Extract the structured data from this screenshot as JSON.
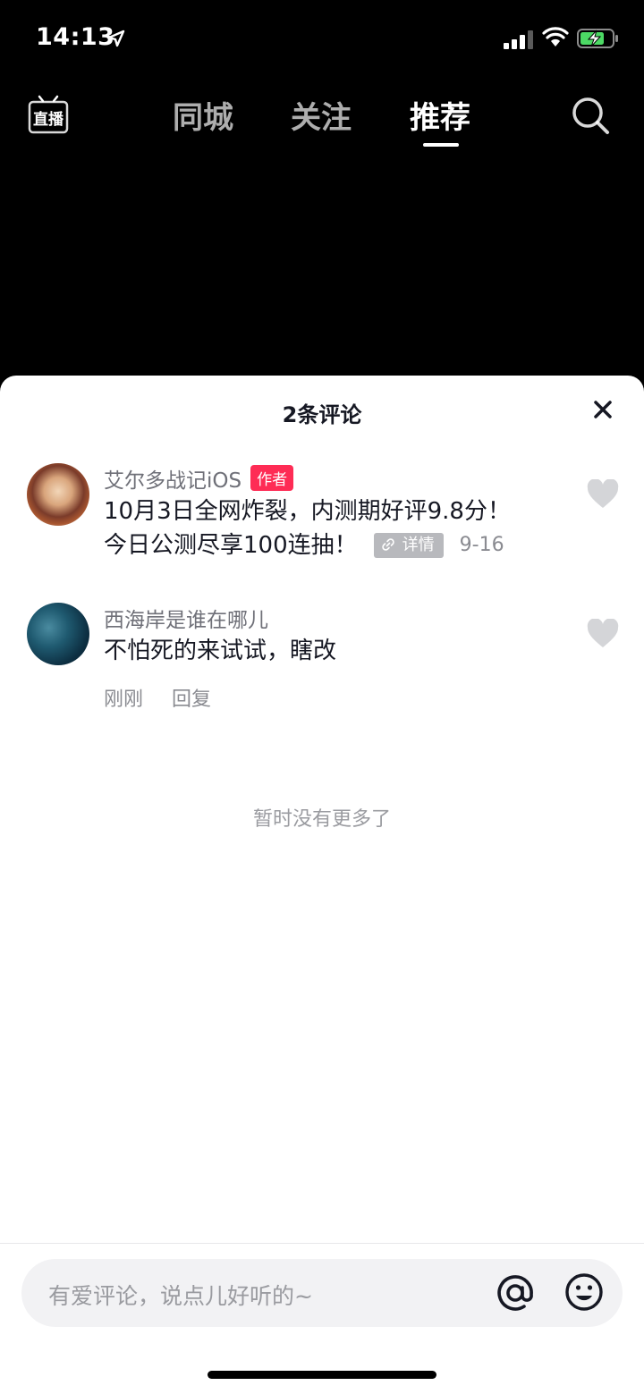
{
  "status_bar": {
    "time": "14:13",
    "icons": [
      "location-arrow-icon",
      "signal-icon",
      "wifi-icon",
      "battery-charging-icon"
    ],
    "battery_color": "#4cd964"
  },
  "top_nav": {
    "live_label": "直播",
    "tabs": [
      {
        "label": "同城"
      },
      {
        "label": "关注"
      },
      {
        "label": "推荐"
      }
    ],
    "active_tab": "推荐",
    "search_icon": "search-icon"
  },
  "comments_sheet": {
    "title": "2条评论",
    "comments": [
      {
        "username": "艾尔多战记iOS",
        "badge": "作者",
        "text_line1": "10月3日全网炸裂，内测期好评9.8分！",
        "text_line2": "今日公测尽享100连抽！",
        "detail_label": "详情",
        "date": "9-16"
      },
      {
        "username": "西海岸是谁在哪儿",
        "text": "不怕死的来试试，瞎改",
        "time": "刚刚",
        "reply_label": "回复"
      }
    ],
    "no_more_text": "暂时没有更多了"
  },
  "input_bar": {
    "placeholder": "有爱评论，说点儿好听的~",
    "at_icon": "at-icon",
    "emoji_icon": "emoji-icon"
  },
  "colors": {
    "accent_badge": "#fe2c55",
    "text_primary": "#161823",
    "text_secondary": "#8a8b91"
  }
}
